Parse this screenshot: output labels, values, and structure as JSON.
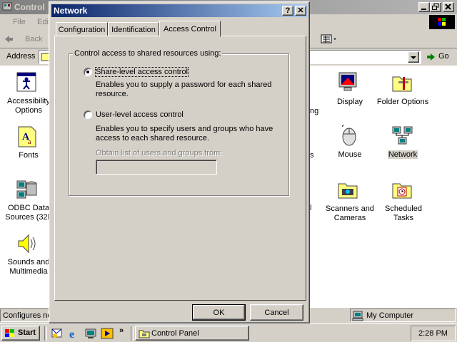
{
  "control_panel": {
    "title": "Control",
    "menu": {
      "file": "File",
      "edit": "Edi"
    },
    "toolbar": {
      "back": "Back"
    },
    "address_label": "Address",
    "go_label": "Go",
    "icons_left": [
      {
        "name": "accessibility-options-icon",
        "label_line1": "Accessibility",
        "label_line2": "Options"
      },
      {
        "name": "fonts-icon",
        "label_line1": "Fonts",
        "label_line2": ""
      },
      {
        "name": "odbc-icon",
        "label_line1": "ODBC Data",
        "label_line2": "Sources (32b"
      },
      {
        "name": "sounds-icon",
        "label_line1": "Sounds and",
        "label_line2": "Multimedia"
      }
    ],
    "partial_labels": {
      "ng": "ng",
      "s": "s",
      "l": "l"
    },
    "icons_right": [
      {
        "name": "display-icon",
        "label_line1": "Display",
        "label_line2": ""
      },
      {
        "name": "folder-options-icon",
        "label_line1": "Folder Options",
        "label_line2": ""
      },
      {
        "name": "mouse-icon",
        "label_line1": "Mouse",
        "label_line2": ""
      },
      {
        "name": "network-icon",
        "label_line1": "Network",
        "label_line2": ""
      },
      {
        "name": "scanners-icon",
        "label_line1": "Scanners and",
        "label_line2": "Cameras"
      },
      {
        "name": "scheduled-tasks-icon",
        "label_line1": "Scheduled",
        "label_line2": "Tasks"
      }
    ],
    "status_left": "Configures ne",
    "status_right": "My Computer"
  },
  "dialog": {
    "title": "Network",
    "help_button": "?",
    "close_button": "✕",
    "tabs": [
      "Configuration",
      "Identification",
      "Access Control"
    ],
    "active_tab": "Access Control",
    "group_label": "Control access to shared resources using:",
    "share_level": {
      "label": "Share-level access control",
      "desc_line1": "Enables you to supply a password for each shared",
      "desc_line2": "resource.",
      "selected": true
    },
    "user_level": {
      "label": "User-level access control",
      "desc_line1": "Enables you to specify users and groups who have",
      "desc_line2": "access to each shared resource.",
      "selected": false
    },
    "obtain_label": "Obtain list of users and groups from:",
    "obtain_value": "",
    "ok": "OK",
    "cancel": "Cancel"
  },
  "taskbar": {
    "start": "Start",
    "more": "»",
    "task": "Control Panel",
    "clock": "2:28 PM"
  },
  "colors": {
    "dialog_title_start": "#0a246a",
    "dialog_title_end": "#a6caf0",
    "face": "#d4d0c8"
  }
}
